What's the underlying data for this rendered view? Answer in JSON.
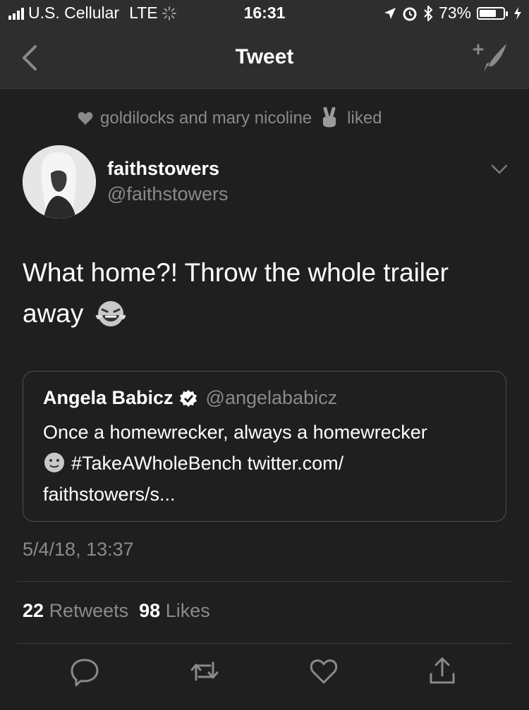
{
  "status_bar": {
    "carrier": "U.S. Cellular",
    "network": "LTE",
    "time": "16:31",
    "battery_percent": "73%",
    "battery_level": 0.73
  },
  "nav": {
    "title": "Tweet"
  },
  "social_context": {
    "text": "goldilocks and mary nicoline",
    "suffix": "liked"
  },
  "tweet": {
    "display_name": "faithstowers",
    "handle": "@faithstowers",
    "text": "What home?! Throw the whole trailer away",
    "timestamp": "5/4/18, 13:37",
    "retweets_count": "22",
    "retweets_label": "Retweets",
    "likes_count": "98",
    "likes_label": "Likes"
  },
  "quoted_tweet": {
    "name": "Angela Babicz",
    "handle": "@angelababicz",
    "line1": "Once a homewrecker, always a homewrecker",
    "line2": "#TakeAWholeBench twitter.com/",
    "line3": "faithstowers/s..."
  },
  "colors": {
    "background": "#1f1f1f",
    "bar": "#2e2e2e",
    "secondary_text": "#8a8a8a",
    "border": "#4d4d4d"
  },
  "icons": [
    "back-chevron-icon",
    "compose-tweet-icon",
    "heart-icon",
    "peace-sign-emoji",
    "chevron-down-icon",
    "laughing-emoji",
    "verified-badge-icon",
    "slight-smile-emoji",
    "reply-icon",
    "retweet-icon",
    "like-icon",
    "share-icon"
  ]
}
